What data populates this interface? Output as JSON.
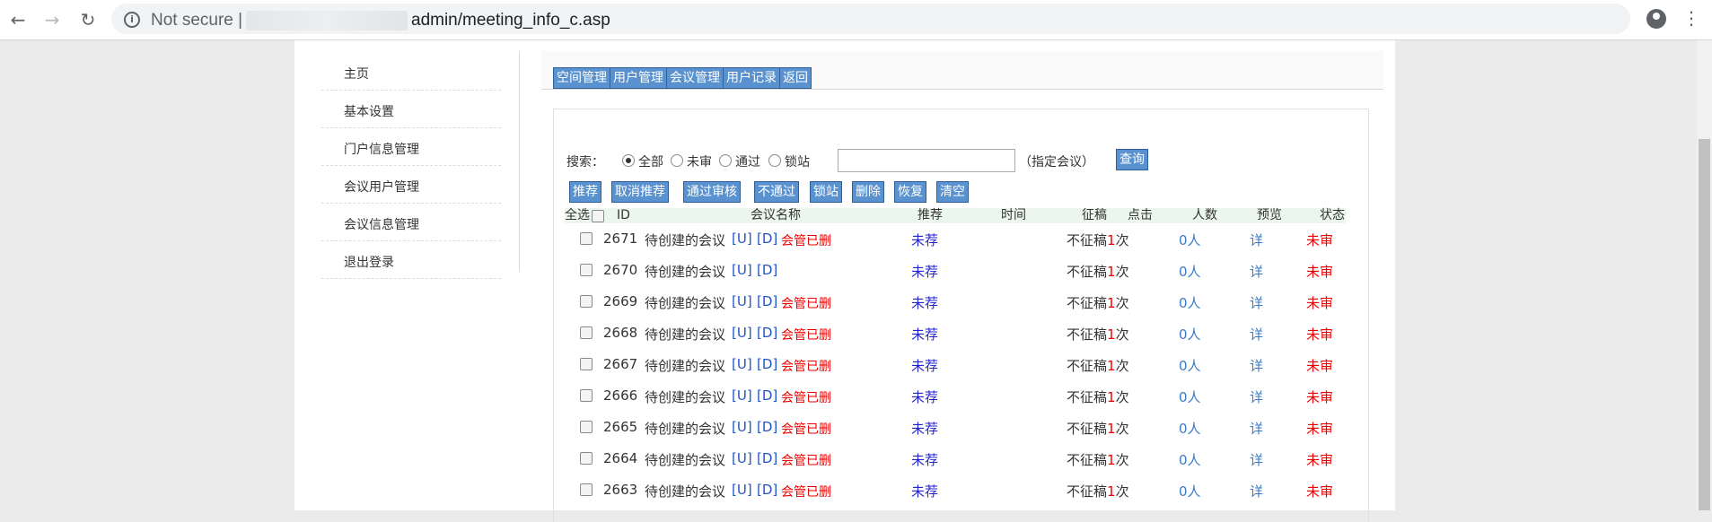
{
  "browser": {
    "security_label": "Not secure",
    "url_separator": "|",
    "url_path": "admin/meeting_info_c.asp"
  },
  "sidebar": {
    "items": [
      {
        "label": "主页"
      },
      {
        "label": "基本设置"
      },
      {
        "label": "门户信息管理"
      },
      {
        "label": "会议用户管理"
      },
      {
        "label": "会议信息管理"
      },
      {
        "label": "退出登录"
      }
    ]
  },
  "topnav": {
    "buttons": [
      "空间管理",
      "用户管理",
      "会议管理",
      "用户记录",
      "返回"
    ]
  },
  "search": {
    "label": "搜索：",
    "options": [
      "全部",
      "未审",
      "通过",
      "锁站"
    ],
    "selected": "全部",
    "input_value": "",
    "hint": "（指定会议）",
    "button": "查询"
  },
  "actions": [
    "推荐",
    "取消推荐",
    "通过审核",
    "不通过",
    "锁站",
    "删除",
    "恢复",
    "清空"
  ],
  "table": {
    "headers": {
      "select_all": "全选",
      "id": "ID",
      "name": "会议名称",
      "recommend": "推荐",
      "time": "时间",
      "collect": "征稿",
      "clicks": "点击",
      "people": "人数",
      "preview": "预览",
      "status": "状态"
    },
    "rows": [
      {
        "id": "2671",
        "name": "待创建的会议",
        "u": "[U]",
        "d": "[D]",
        "note": "会管已删",
        "recommend": "未荐",
        "time": "",
        "collect": "不征稿",
        "clicks": "1",
        "clicks_unit": "次",
        "people": "0人",
        "preview": "详",
        "status": "未审"
      },
      {
        "id": "2670",
        "name": "待创建的会议",
        "u": "[U]",
        "d": "[D]",
        "note": "",
        "recommend": "未荐",
        "time": "",
        "collect": "不征稿",
        "clicks": "1",
        "clicks_unit": "次",
        "people": "0人",
        "preview": "详",
        "status": "未审"
      },
      {
        "id": "2669",
        "name": "待创建的会议",
        "u": "[U]",
        "d": "[D]",
        "note": "会管已删",
        "recommend": "未荐",
        "time": "",
        "collect": "不征稿",
        "clicks": "1",
        "clicks_unit": "次",
        "people": "0人",
        "preview": "详",
        "status": "未审"
      },
      {
        "id": "2668",
        "name": "待创建的会议",
        "u": "[U]",
        "d": "[D]",
        "note": "会管已删",
        "recommend": "未荐",
        "time": "",
        "collect": "不征稿",
        "clicks": "1",
        "clicks_unit": "次",
        "people": "0人",
        "preview": "详",
        "status": "未审"
      },
      {
        "id": "2667",
        "name": "待创建的会议",
        "u": "[U]",
        "d": "[D]",
        "note": "会管已删",
        "recommend": "未荐",
        "time": "",
        "collect": "不征稿",
        "clicks": "1",
        "clicks_unit": "次",
        "people": "0人",
        "preview": "详",
        "status": "未审"
      },
      {
        "id": "2666",
        "name": "待创建的会议",
        "u": "[U]",
        "d": "[D]",
        "note": "会管已删",
        "recommend": "未荐",
        "time": "",
        "collect": "不征稿",
        "clicks": "1",
        "clicks_unit": "次",
        "people": "0人",
        "preview": "详",
        "status": "未审"
      },
      {
        "id": "2665",
        "name": "待创建的会议",
        "u": "[U]",
        "d": "[D]",
        "note": "会管已删",
        "recommend": "未荐",
        "time": "",
        "collect": "不征稿",
        "clicks": "1",
        "clicks_unit": "次",
        "people": "0人",
        "preview": "详",
        "status": "未审"
      },
      {
        "id": "2664",
        "name": "待创建的会议",
        "u": "[U]",
        "d": "[D]",
        "note": "会管已删",
        "recommend": "未荐",
        "time": "",
        "collect": "不征稿",
        "clicks": "1",
        "clicks_unit": "次",
        "people": "0人",
        "preview": "详",
        "status": "未审"
      },
      {
        "id": "2663",
        "name": "待创建的会议",
        "u": "[U]",
        "d": "[D]",
        "note": "会管已删",
        "recommend": "未荐",
        "time": "",
        "collect": "不征稿",
        "clicks": "1",
        "clicks_unit": "次",
        "people": "0人",
        "preview": "详",
        "status": "未审"
      }
    ]
  },
  "icons": {
    "back": "back-arrow-icon",
    "forward": "forward-arrow-icon",
    "reload": "reload-icon",
    "info": "info-icon",
    "bookmark": "star-icon",
    "profile": "profile-icon",
    "menu": "kebab-menu-icon"
  }
}
